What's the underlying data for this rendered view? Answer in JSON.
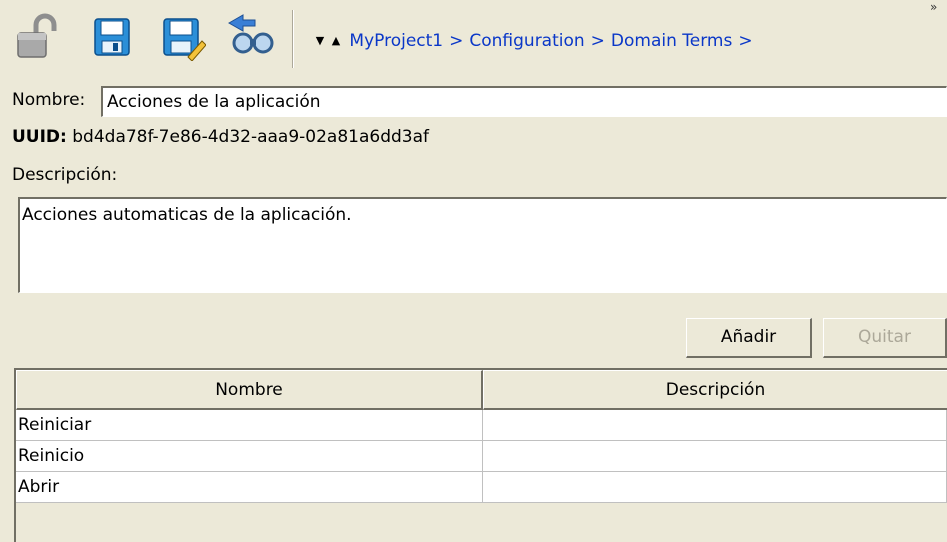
{
  "toolbar": {
    "icons": [
      "lock-open-icon",
      "save-icon",
      "save-as-icon",
      "find-references-icon"
    ],
    "nav_down_glyph": "▼",
    "nav_up_glyph": "▲",
    "breadcrumb": [
      "MyProject1",
      "Configuration",
      "Domain Terms"
    ],
    "breadcrumb_sep": ">",
    "overflow_glyph": "»"
  },
  "form": {
    "name_label": "Nombre:",
    "name_value": "Acciones de la aplicación",
    "uuid_label": "UUID:",
    "uuid_value": "bd4da78f-7e86-4d32-aaa9-02a81a6dd3af",
    "description_label": "Descripción:",
    "description_value": "Acciones automaticas de la aplicación."
  },
  "buttons": {
    "add": "Añadir",
    "remove": "Quitar"
  },
  "table": {
    "headers": [
      "Nombre",
      "Descripción"
    ],
    "rows": [
      [
        "Reiniciar",
        ""
      ],
      [
        "Reinicio",
        ""
      ],
      [
        "Abrir",
        ""
      ]
    ]
  },
  "colors": {
    "background": "#ece9d8",
    "link": "#0a37c8",
    "disabled_text": "#aca899"
  }
}
